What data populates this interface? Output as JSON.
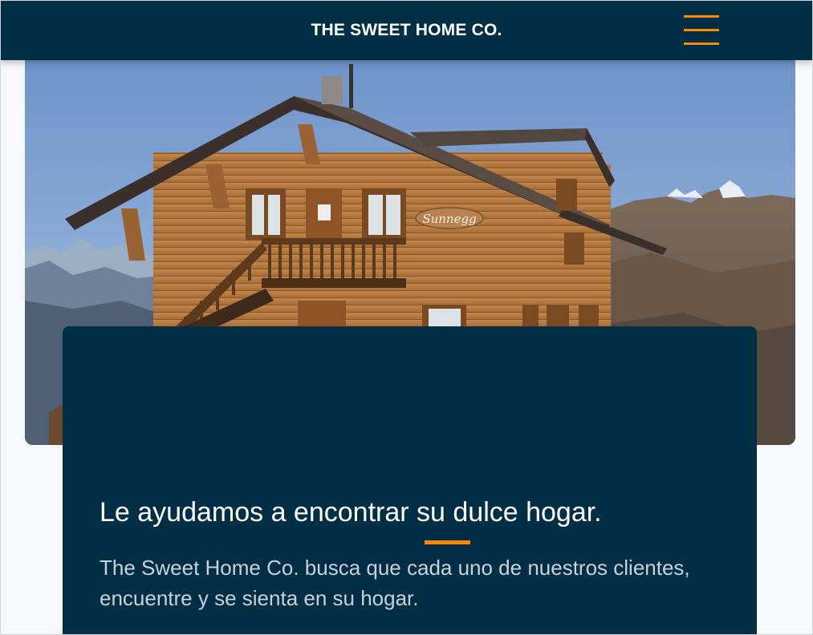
{
  "header": {
    "brand": "THE SWEET HOME CO.",
    "menu_icon": "hamburger-menu-icon",
    "accent_color": "#ff8a00",
    "background_color": "#002e45"
  },
  "hero": {
    "image": "wooden-chalet-mountains",
    "sign_text": "Sunnegg"
  },
  "intro_card": {
    "title": "Le ayudamos a encontrar su dulce hogar.",
    "text": "The Sweet Home Co. busca que cada uno de nuestros clientes, encuentre y se sienta en su hogar."
  }
}
